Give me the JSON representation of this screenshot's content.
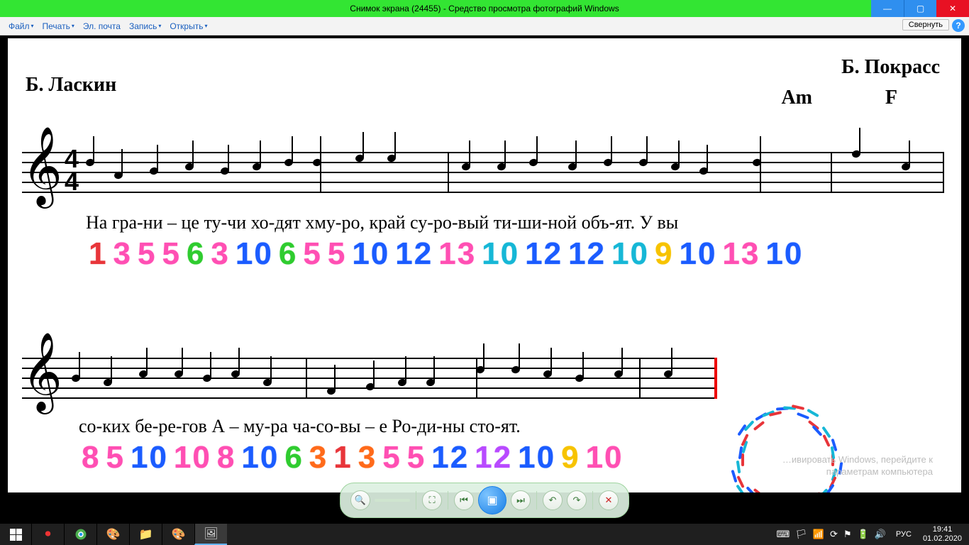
{
  "window": {
    "title": "Снимок экрана (24455) - Средство просмотра фотографий Windows"
  },
  "menu": {
    "file": "Файл",
    "print": "Печать",
    "email": "Эл. почта",
    "burn": "Запись",
    "open": "Открыть",
    "collapse": "Свернуть"
  },
  "sheet": {
    "author_left": "Б. Ласкин",
    "author_right": "Б. Покрасс",
    "chord_am": "Am",
    "chord_f": "F",
    "lyrics_line1": "На гра-ни – це ту-чи хо-дят хму-ро,    край су-ро-вый ти-ши-ной объ-ят.       У вы",
    "lyrics_line2": "со-ких бе-ре-гов А – му-ра       ча-со-вы – е Ро-ди-ны сто-ят.",
    "time_top": "4",
    "time_bot": "4"
  },
  "numbers_line1": [
    {
      "v": "1",
      "c": "c-red"
    },
    {
      "v": "3",
      "c": "c-pink"
    },
    {
      "v": "5",
      "c": "c-pink"
    },
    {
      "v": "5",
      "c": "c-pink"
    },
    {
      "v": "6",
      "c": "c-green"
    },
    {
      "v": "3",
      "c": "c-pink"
    },
    {
      "v": "10",
      "c": "c-blue"
    },
    {
      "v": "6",
      "c": "c-green"
    },
    {
      "v": "5",
      "c": "c-pink"
    },
    {
      "v": "5",
      "c": "c-pink"
    },
    {
      "v": "10",
      "c": "c-blue"
    },
    {
      "v": "12",
      "c": "c-blue"
    },
    {
      "v": "13",
      "c": "c-pink"
    },
    {
      "v": "10",
      "c": "c-cyan"
    },
    {
      "v": "12",
      "c": "c-blue"
    },
    {
      "v": "12",
      "c": "c-blue"
    },
    {
      "v": "10",
      "c": "c-cyan"
    },
    {
      "v": "9",
      "c": "c-yellow"
    },
    {
      "v": "10",
      "c": "c-blue"
    },
    {
      "v": "13",
      "c": "c-pink"
    },
    {
      "v": "10",
      "c": "c-blue"
    }
  ],
  "numbers_line2": [
    {
      "v": "8",
      "c": "c-pink"
    },
    {
      "v": "5",
      "c": "c-pink"
    },
    {
      "v": "10",
      "c": "c-blue"
    },
    {
      "v": "10",
      "c": "c-pink"
    },
    {
      "v": "8",
      "c": "c-pink"
    },
    {
      "v": "10",
      "c": "c-blue"
    },
    {
      "v": "6",
      "c": "c-green"
    },
    {
      "v": "3",
      "c": "c-dkorange"
    },
    {
      "v": "1",
      "c": "c-red"
    },
    {
      "v": "3",
      "c": "c-dkorange"
    },
    {
      "v": "5",
      "c": "c-pink"
    },
    {
      "v": "5",
      "c": "c-pink"
    },
    {
      "v": "12",
      "c": "c-blue"
    },
    {
      "v": "12",
      "c": "c-purple"
    },
    {
      "v": "10",
      "c": "c-blue"
    },
    {
      "v": "9",
      "c": "c-yellow"
    },
    {
      "v": "10",
      "c": "c-pink"
    }
  ],
  "watermark": {
    "l1": "…ивировать Windows, перейдите к",
    "l2": "параметрам компьютера"
  },
  "tray": {
    "lang": "РУС",
    "time": "19:41",
    "date": "01.02.2020"
  }
}
